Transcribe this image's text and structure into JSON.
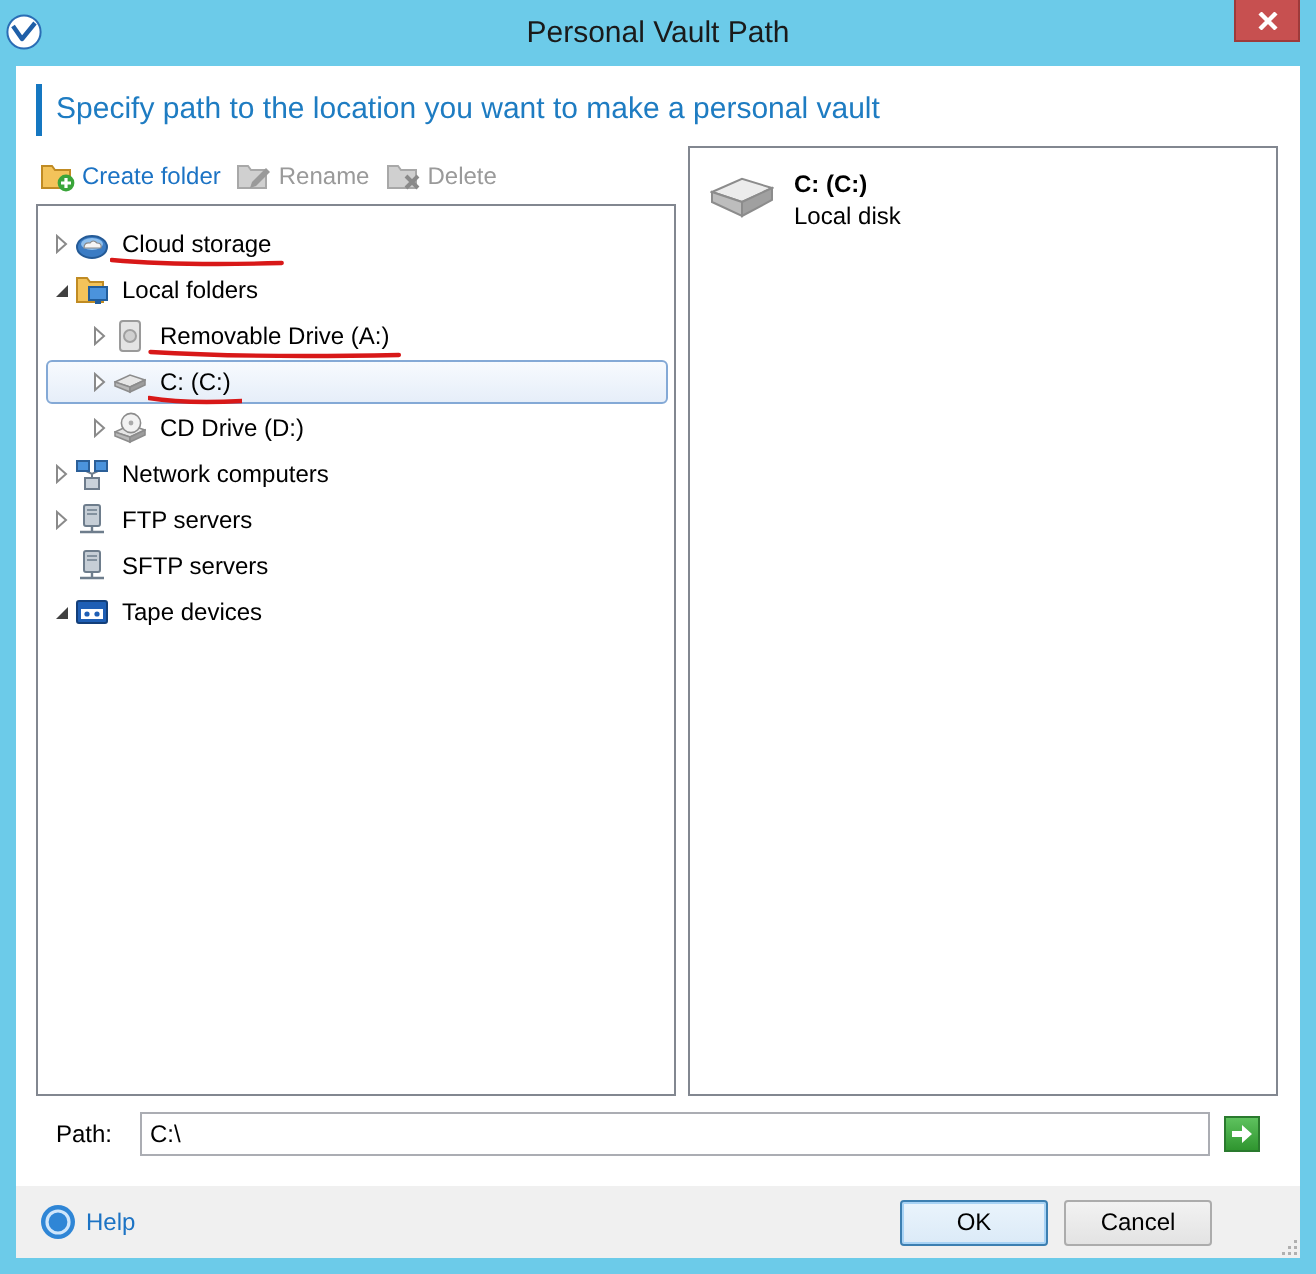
{
  "window": {
    "title": "Personal Vault Path"
  },
  "heading": "Specify path to the location you want to make a personal vault",
  "toolbar": [
    {
      "label": "Create folder",
      "kind": "create",
      "disabled": false
    },
    {
      "label": "Rename",
      "kind": "rename",
      "disabled": true
    },
    {
      "label": "Delete",
      "kind": "delete",
      "disabled": true
    }
  ],
  "tree": [
    {
      "label": "Cloud storage",
      "kind": "cloud",
      "expandable": true,
      "expanded": false,
      "selected": false,
      "underlined": true
    },
    {
      "label": "Local folders",
      "kind": "local",
      "expandable": true,
      "expanded": true,
      "selected": false,
      "underlined": false,
      "children": [
        {
          "label": "Removable Drive (A:)",
          "kind": "removable",
          "expandable": true,
          "expanded": false,
          "selected": false,
          "underlined": true
        },
        {
          "label": "C: (C:)",
          "kind": "disk",
          "expandable": true,
          "expanded": false,
          "selected": true,
          "underlined": true
        },
        {
          "label": "CD Drive (D:)",
          "kind": "cd",
          "expandable": true,
          "expanded": false,
          "selected": false,
          "underlined": false
        }
      ]
    },
    {
      "label": "Network computers",
      "kind": "network",
      "expandable": true,
      "expanded": false,
      "selected": false,
      "underlined": false
    },
    {
      "label": "FTP servers",
      "kind": "ftp",
      "expandable": true,
      "expanded": false,
      "selected": false,
      "underlined": false
    },
    {
      "label": "SFTP servers",
      "kind": "sftp",
      "expandable": false,
      "selected": false,
      "underlined": false
    },
    {
      "label": "Tape devices",
      "kind": "tape",
      "expandable": true,
      "expanded": true,
      "selected": false,
      "underlined": false
    }
  ],
  "details": [
    {
      "title": "C: (C:)",
      "subtitle": "Local disk",
      "kind": "disk"
    }
  ],
  "path": {
    "label": "Path:",
    "value": "C:\\"
  },
  "help": {
    "label": "Help"
  },
  "buttons": [
    {
      "label": "OK",
      "default": true
    },
    {
      "label": "Cancel",
      "default": false
    }
  ]
}
